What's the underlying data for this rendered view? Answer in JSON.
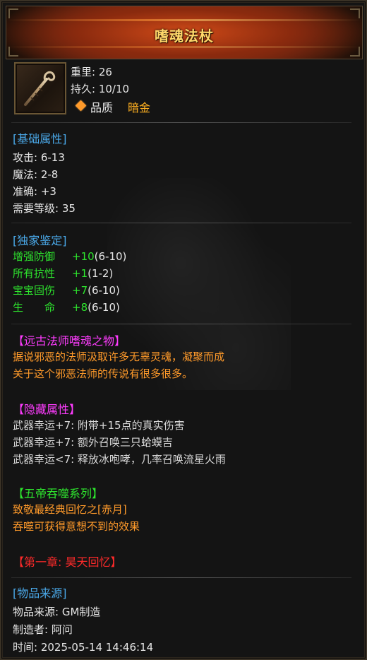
{
  "item": {
    "name": "嗜魂法杖",
    "icon": "staff-icon",
    "weight_label": "重里:",
    "weight_value": "26",
    "durability_label": "持久:",
    "durability_value": "10/10",
    "quality_label": "品质",
    "quality_value": "暗金"
  },
  "base": {
    "header": "[基础属性]",
    "lines": [
      "攻击: 6-13",
      "魔法: 2-8",
      "准确: +3",
      "需要等级: 35"
    ]
  },
  "ident": {
    "header": "[独家鉴定]",
    "rows": [
      {
        "name": "增强防御",
        "value": "+10",
        "range": "(6-10)"
      },
      {
        "name": "所有抗性",
        "value": "+1",
        "range": "(1-2)"
      },
      {
        "name": "宝宝固伤",
        "value": "+7",
        "range": "(6-10)"
      },
      {
        "name": "生　　命",
        "value": "+8",
        "range": "(6-10)"
      }
    ]
  },
  "lore": {
    "header": "【远古法师嗜魂之物】",
    "lines": [
      "据说邪恶的法师汲取许多无辜灵魂，凝聚而成",
      "关于这个邪恶法师的传说有很多很多。"
    ]
  },
  "hidden": {
    "header": "【隐藏属性】",
    "lines": [
      "武器幸运+7: 附带+15点的真实伤害",
      "武器幸运+7: 额外召唤三只蛤蟆吉",
      "武器幸运<7: 释放冰咆哮，几率召唤流星火雨"
    ]
  },
  "series": {
    "header": "【五帝吞噬系列】",
    "lines": [
      "致敬最经典回忆之[赤月]",
      "吞噬可获得意想不到的效果"
    ]
  },
  "chapter": {
    "header": "【第一章: 昊天回忆】"
  },
  "source": {
    "header": "[物品来源]",
    "lines": [
      "物品来源: GM制造",
      "制造者: 阿问",
      "时间: 2025-05-14 14:46:14"
    ]
  },
  "colors": {
    "title": "#ffd86a",
    "section_blue": "#4aa8e8",
    "ident_green": "#2ee62e",
    "lore_magenta": "#ff3cff",
    "lore_orange": "#ff9a2a",
    "chapter_red": "#ff2a2a",
    "quality_gold": "#ffb020"
  }
}
